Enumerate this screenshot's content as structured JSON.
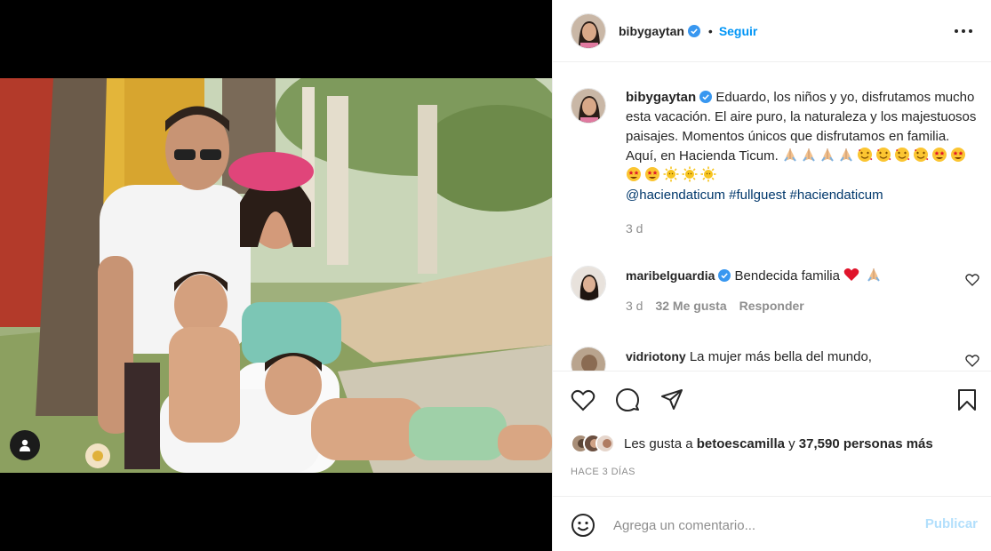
{
  "post": {
    "username": "bibygaytan",
    "follow_dot": "•",
    "follow_label": "Seguir",
    "more_label": "•••"
  },
  "caption": {
    "username": "bibygaytan",
    "text": "Eduardo, los niños y yo, disfrutamos mucho esta vacación. El aire puro, la naturaleza y los majestuosos paisajes. Momentos únicos que disfrutamos en familia. Aquí, en Hacienda Ticum.",
    "emojis": [
      "folded-hands",
      "folded-hands",
      "folded-hands",
      "folded-hands",
      "smiling-hearts",
      "smiling-hearts",
      "smiling-hearts",
      "smiling-hearts",
      "star-struck",
      "star-struck",
      "star-struck",
      "star-struck",
      "sun",
      "sun",
      "sun"
    ],
    "mention": "@haciendaticum",
    "tags": [
      "#fullguest",
      "#haciendaticum"
    ],
    "time": "3 d"
  },
  "comments": [
    {
      "username": "maribelguardia",
      "text": "Bendecida familia",
      "time": "3 d",
      "likes": "32 Me gusta",
      "reply": "Responder"
    },
    {
      "username": "vidriotony",
      "text": "La mujer más bella del mundo,"
    }
  ],
  "likes": {
    "prefix": "Les gusta a",
    "first_user": "betoescamilla",
    "joiner": "y",
    "others": "37,590 personas más"
  },
  "posted_ago": "HACE 3 DÍAS",
  "comment_box": {
    "placeholder": "Agrega un comentario...",
    "publish_label": "Publicar"
  },
  "colors": {
    "accent": "#0095f6",
    "publish_disabled": "#b2dffc",
    "muted": "#8e8e8e",
    "link": "#00376b"
  }
}
